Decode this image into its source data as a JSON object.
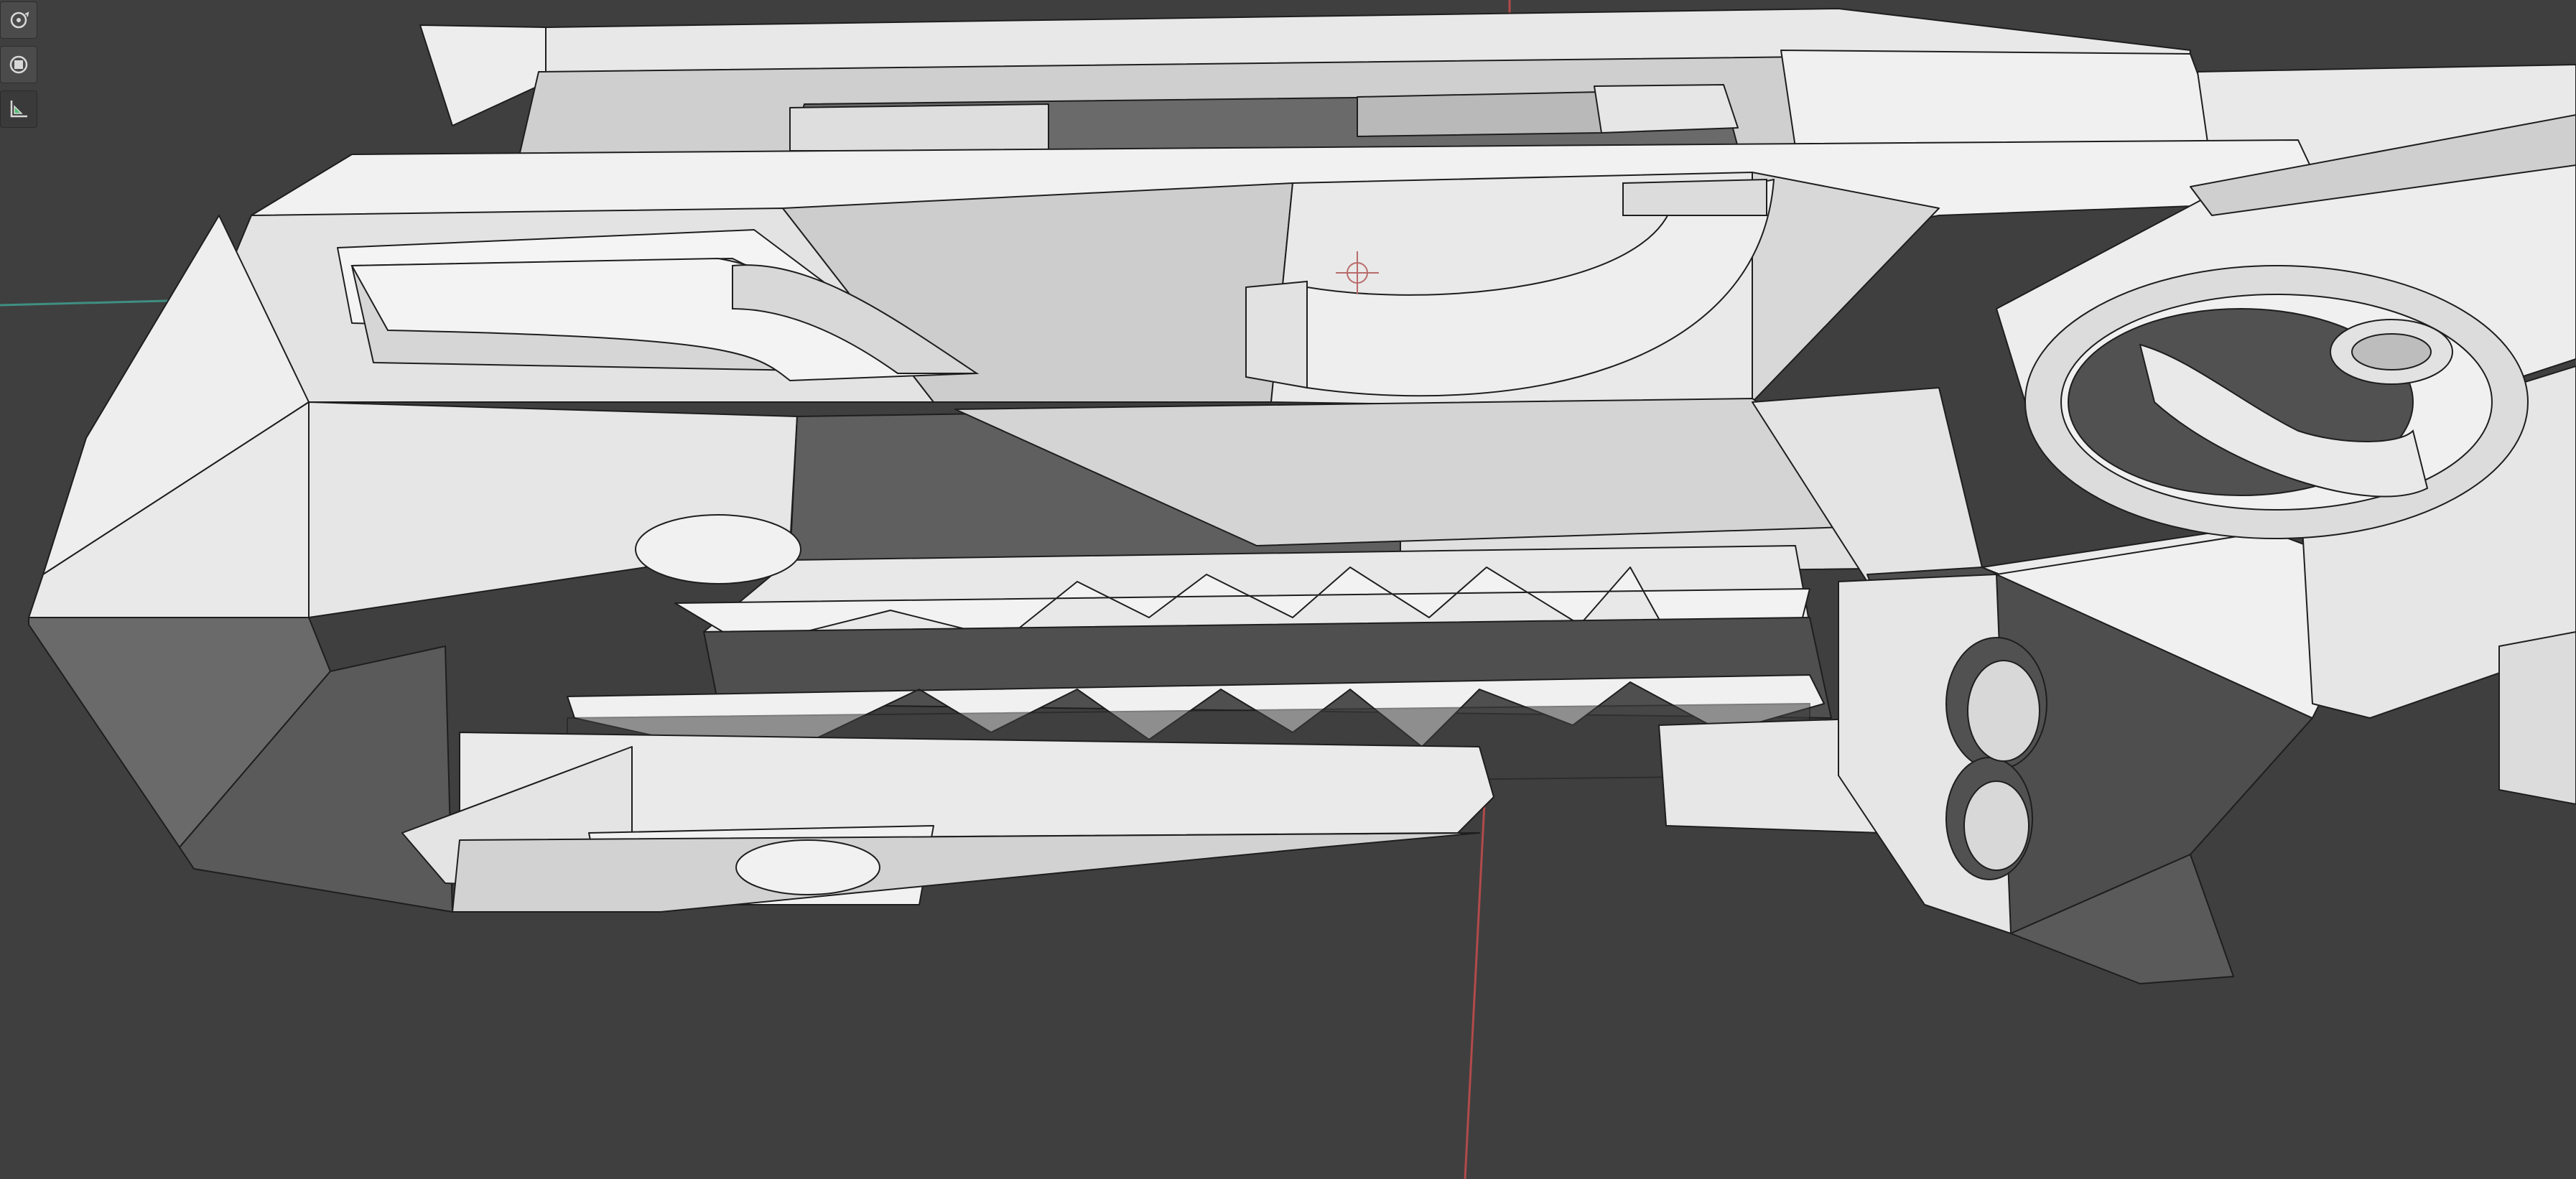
{
  "viewport": {
    "background_color": "#3f3f3f",
    "mesh_light_color": "#eeeeee",
    "mesh_mid_color": "#bdbdbd",
    "mesh_dark_color": "#5a5a5a",
    "wire_color": "#1e1e1e",
    "axis_x_color": "#b24a4a",
    "axis_y_color": "#3f8f82"
  },
  "toolbar": {
    "items": [
      {
        "icon": "orbit-icon",
        "active": false
      },
      {
        "icon": "frame-selection-icon",
        "active": false
      },
      {
        "icon": "ruler-measure-icon",
        "active": true
      }
    ]
  }
}
